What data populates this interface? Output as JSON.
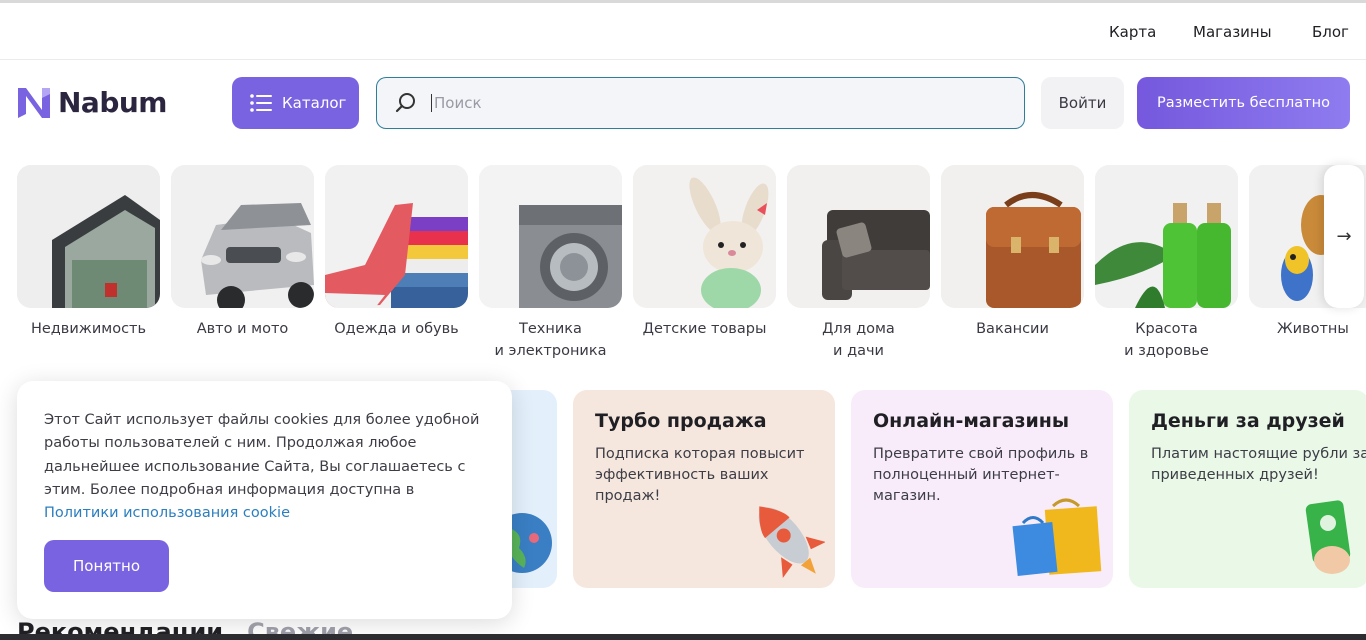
{
  "top_nav": {
    "map": "Карта",
    "shops": "Магазины",
    "blog": "Блог"
  },
  "brand": {
    "name": "Nabum",
    "accent": "#7a63e0"
  },
  "header": {
    "catalog_label": "Каталог",
    "search_placeholder": "Поиск",
    "login_label": "Войти",
    "post_label": "Разместить бесплатно"
  },
  "categories": [
    {
      "line1": "Недвижимость",
      "line2": "",
      "icon": "house"
    },
    {
      "line1": "Авто и мото",
      "line2": "",
      "icon": "car"
    },
    {
      "line1": "Одежда и обувь",
      "line2": "",
      "icon": "sneaker"
    },
    {
      "line1": "Техника",
      "line2": "и электроника",
      "icon": "washing-machine"
    },
    {
      "line1": "Детские товары",
      "line2": "",
      "icon": "plush-bunny"
    },
    {
      "line1": "Для дома",
      "line2": "и дачи",
      "icon": "sofa"
    },
    {
      "line1": "Вакансии",
      "line2": "",
      "icon": "briefcase"
    },
    {
      "line1": "Красота",
      "line2": "и здоровье",
      "icon": "bottles"
    },
    {
      "line1": "Животны",
      "line2": "",
      "icon": "dog-parrot"
    }
  ],
  "promos": [
    {
      "title": "Турбо продажа",
      "text": "Подписка которая повысит эффективность ваших продаж!",
      "bg": "#f6e7de"
    },
    {
      "title": "Онлайн-магазины",
      "text": "Превратите свой профиль в полноценный интернет-магазин.",
      "bg": "#f8ecfb"
    },
    {
      "title": "Деньги за друзей",
      "text": "Платим настоящие рубли за приведенных друзей!",
      "bg": "#eaf8e8"
    }
  ],
  "cookie": {
    "text": "Этот Сайт использует файлы cookies для более удобной работы пользователей с ним. Продолжая любое дальнейшее использование Сайта, Вы соглашаетесь с этим. Более подробная информация доступна в ",
    "link": "Политики использования cookie",
    "button": "Понятно"
  },
  "sections": {
    "recommended": "Рекомендации",
    "fresh": "Свежие"
  }
}
